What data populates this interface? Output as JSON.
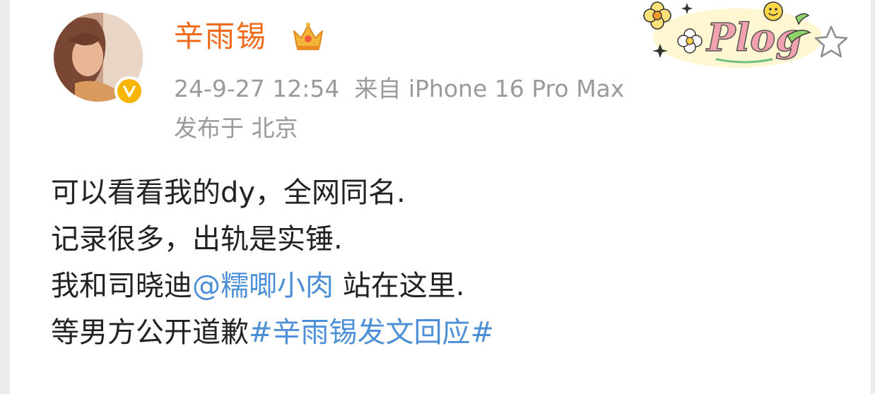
{
  "post": {
    "username": "辛雨锡",
    "timestamp": "24-9-27 12:54",
    "source": "来自 iPhone 16 Pro Max",
    "location": "发布于 北京",
    "decor_text": "Plog",
    "lines": [
      {
        "text": "可以看看我的dy，全网同名."
      },
      {
        "text": "记录很多，出轨是实锤."
      },
      {
        "pre": "我和司晓迪",
        "mention": "@糯唧小肉",
        "post": " 站在这里."
      },
      {
        "pre": "等男方公开道歉",
        "hashtag": "#辛雨锡发文回应#"
      }
    ]
  },
  "icons": {
    "verified": "verified-badge-icon",
    "crown": "crown-icon",
    "favorite": "star-outline-icon"
  },
  "colors": {
    "username": "#ef6a1b",
    "meta": "#9a9a9a",
    "body": "#222222",
    "link": "#4d8fd6",
    "badge": "#f7b500"
  }
}
